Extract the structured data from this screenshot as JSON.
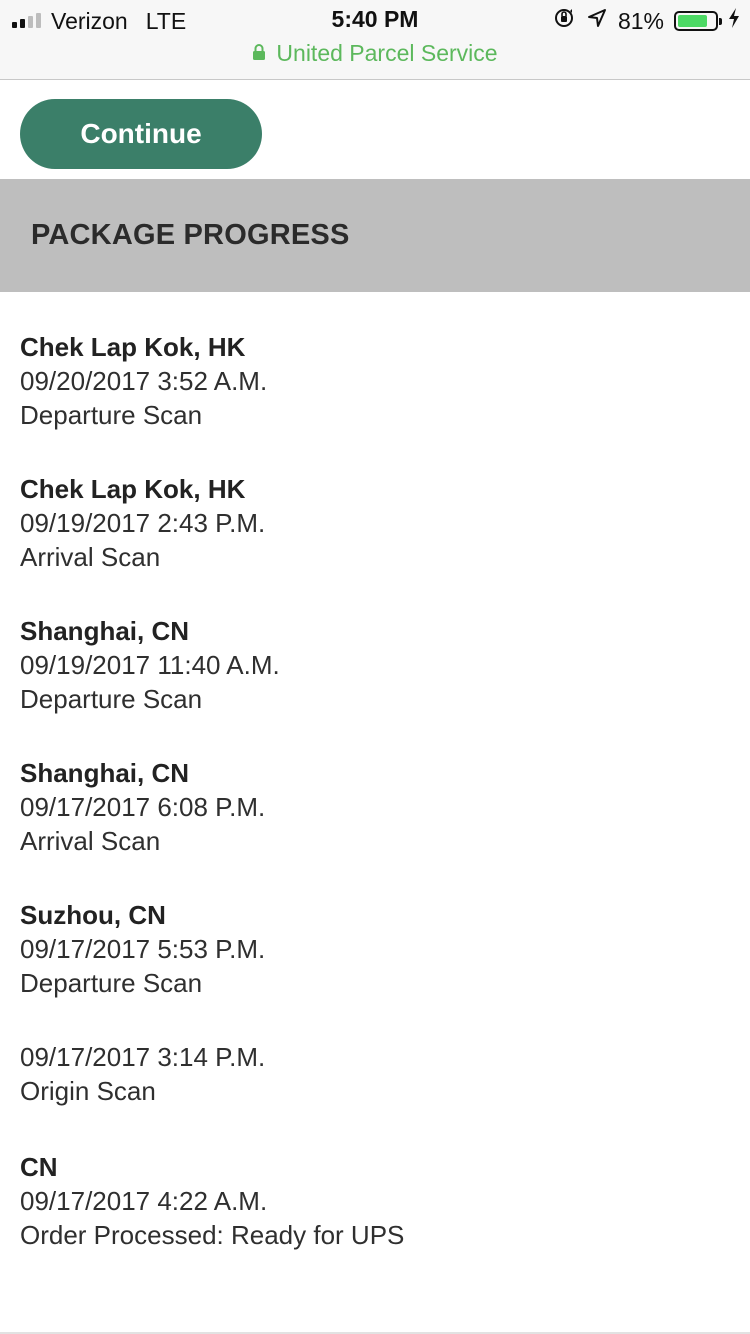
{
  "status_bar": {
    "carrier": "Verizon",
    "network": "LTE",
    "time": "5:40 PM",
    "battery_percent": "81%",
    "battery_level": 0.81,
    "icons": [
      "signal-icon",
      "orientation-lock-icon",
      "location-icon",
      "battery-icon",
      "charging-icon"
    ]
  },
  "browser": {
    "site_name": "United Parcel Service",
    "secure_color": "#5cb85c"
  },
  "actions": {
    "continue_label": "Continue"
  },
  "section": {
    "title": "PACKAGE PROGRESS"
  },
  "events": [
    {
      "location": "Chek Lap Kok, HK",
      "datetime": "09/20/2017 3:52 A.M.",
      "activity": "Departure Scan"
    },
    {
      "location": "Chek Lap Kok, HK",
      "datetime": "09/19/2017 2:43 P.M.",
      "activity": "Arrival Scan"
    },
    {
      "location": "Shanghai, CN",
      "datetime": "09/19/2017 11:40 A.M.",
      "activity": "Departure Scan"
    },
    {
      "location": "Shanghai, CN",
      "datetime": "09/17/2017 6:08 P.M.",
      "activity": "Arrival Scan"
    },
    {
      "location": "Suzhou, CN",
      "datetime": "09/17/2017 5:53 P.M.",
      "activity": "Departure Scan"
    },
    {
      "location": "",
      "datetime": "09/17/2017 3:14 P.M.",
      "activity": "Origin Scan"
    },
    {
      "location": "CN",
      "datetime": "09/17/2017 4:22 A.M.",
      "activity": "Order Processed: Ready for UPS"
    }
  ],
  "colors": {
    "button": "#3b7f69",
    "header_bg": "#bebebe",
    "battery_fill": "#4cd964"
  }
}
